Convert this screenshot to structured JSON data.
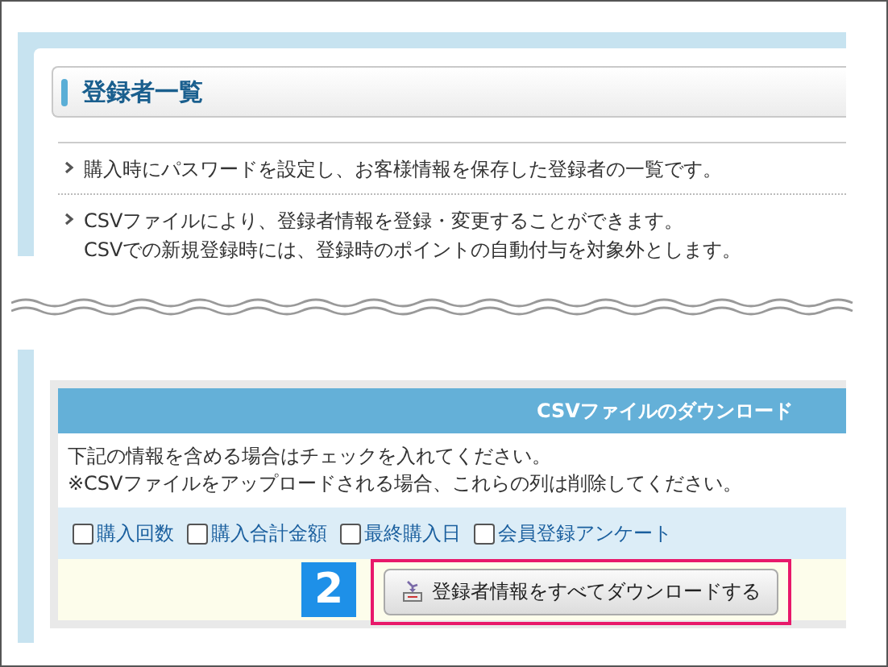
{
  "section_title": "登録者一覧",
  "notes": [
    {
      "lines": [
        "購入時にパスワードを設定し、お客様情報を保存した登録者の一覧です。"
      ]
    },
    {
      "lines": [
        "CSVファイルにより、登録者情報を登録・変更することができます。",
        "CSVでの新規登録時には、登録時のポイントの自動付与を対象外とします。"
      ]
    }
  ],
  "csv_panel": {
    "title": "CSVファイルのダウンロード",
    "instructions": [
      "下記の情報を含める場合はチェックを入れてください。",
      "※CSVファイルをアップロードされる場合、これらの列は削除してください。"
    ],
    "options": [
      {
        "label": "購入回数",
        "checked": false
      },
      {
        "label": "購入合計金額",
        "checked": false
      },
      {
        "label": "最終購入日",
        "checked": false
      },
      {
        "label": "会員登録アンケート",
        "checked": false
      }
    ],
    "step_badge": "2",
    "download_button": {
      "label": "登録者情報をすべてダウンロードする",
      "highlighted": true
    }
  }
}
